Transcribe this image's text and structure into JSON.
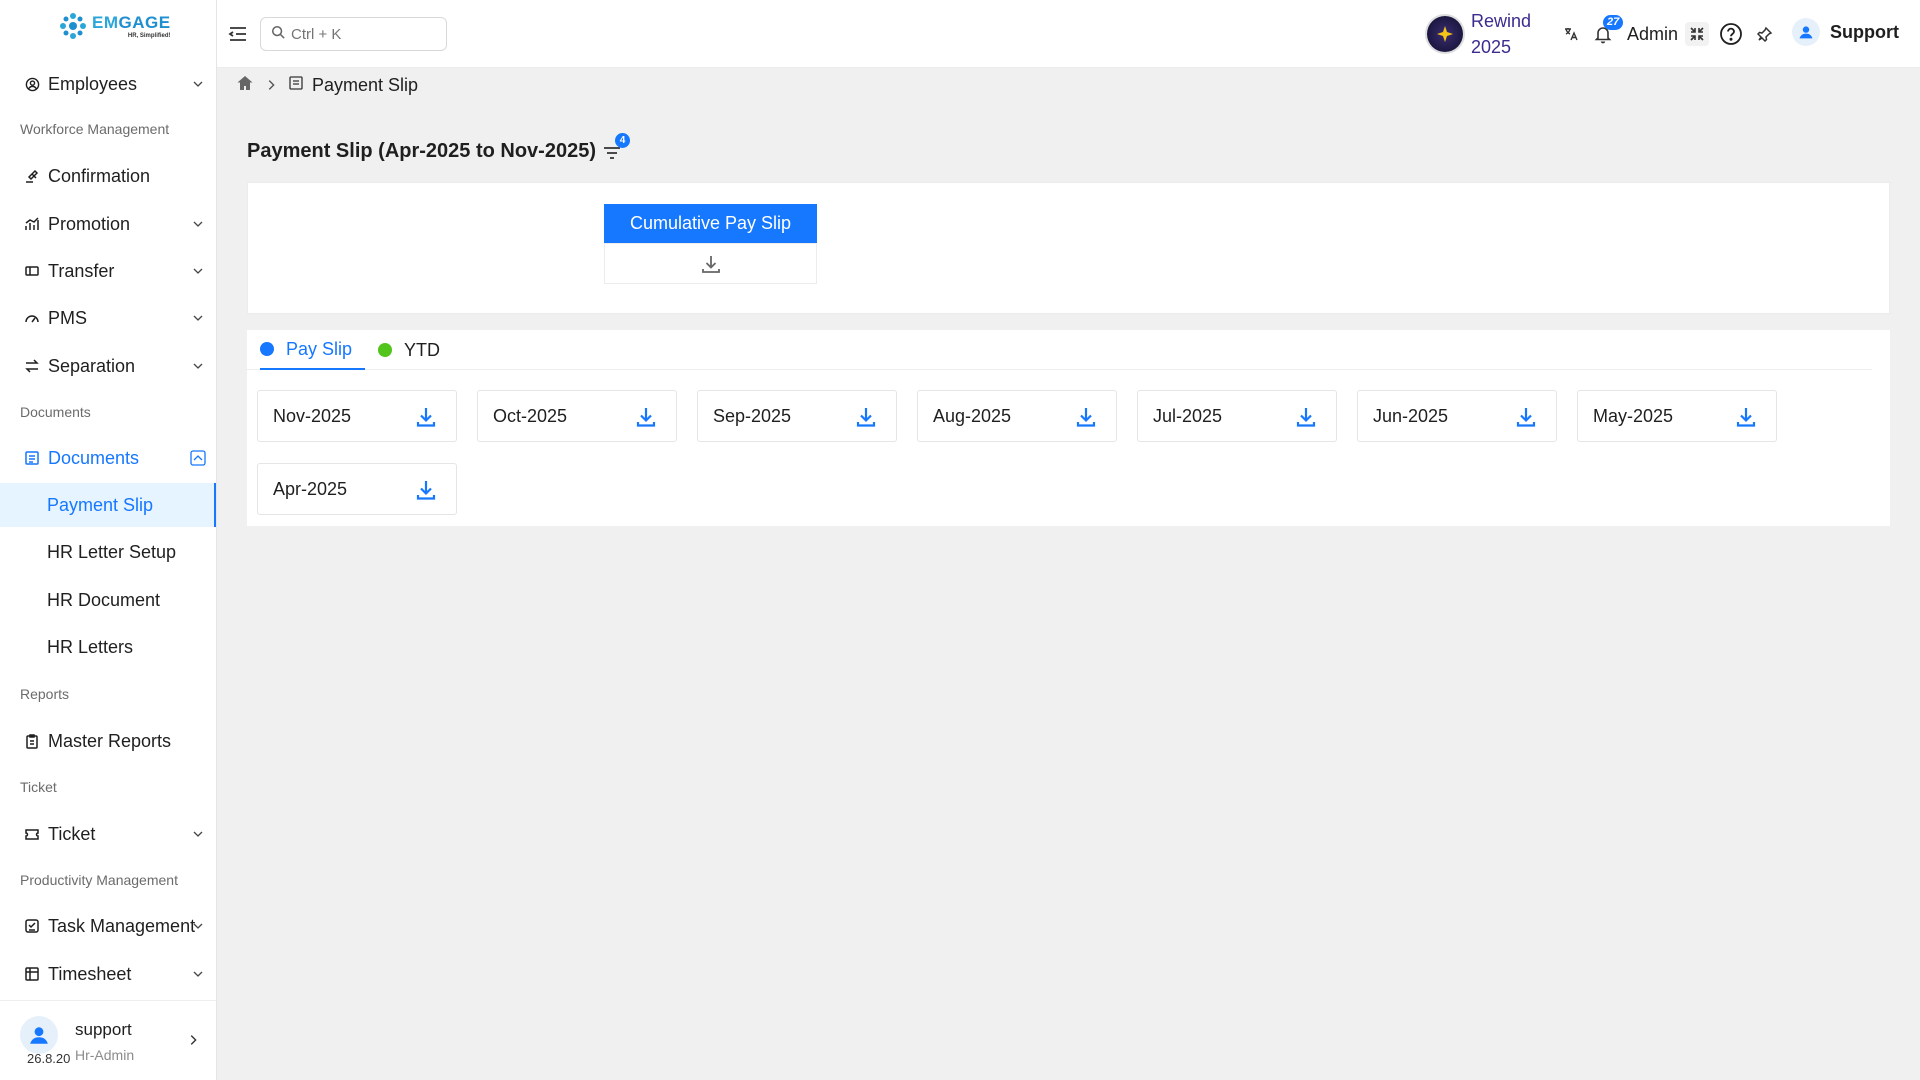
{
  "logo": {
    "word_em": "EM",
    "word_gage": "GAGE",
    "tagline": "HR, Simplified!"
  },
  "sidebar": {
    "items": [
      {
        "label": "Employees",
        "icon": "user-circle-icon"
      },
      {
        "label": "Confirmation",
        "icon": "gavel-icon"
      },
      {
        "label": "Promotion",
        "icon": "chart-icon"
      },
      {
        "label": "Transfer",
        "icon": "transfer-icon"
      },
      {
        "label": "PMS",
        "icon": "gauge-icon"
      },
      {
        "label": "Separation",
        "icon": "swap-icon"
      },
      {
        "label": "Documents",
        "icon": "document-icon"
      },
      {
        "label": "Payment Slip"
      },
      {
        "label": "HR Letter Setup"
      },
      {
        "label": "HR Document"
      },
      {
        "label": "HR Letters"
      },
      {
        "label": "Master Reports",
        "icon": "clipboard-icon"
      },
      {
        "label": "Ticket",
        "icon": "ticket-icon"
      },
      {
        "label": "Task Management",
        "icon": "task-icon"
      },
      {
        "label": "Timesheet",
        "icon": "table-icon"
      }
    ],
    "groups": {
      "workforce": "Workforce Management",
      "documents": "Documents",
      "reports": "Reports",
      "ticket": "Ticket",
      "productivity": "Productivity Management"
    },
    "user": {
      "name": "support",
      "role": "Hr-Admin",
      "version": "26.8.20"
    }
  },
  "header": {
    "search_placeholder": "Ctrl + K",
    "rewind_line1": "Rewind",
    "rewind_line2": "2025",
    "notif_count": "27",
    "role": "Admin",
    "user": "Support"
  },
  "breadcrumb": {
    "current": "Payment Slip"
  },
  "page": {
    "title": "Payment Slip (Apr-2025 to Nov-2025)",
    "filter_count": "4",
    "cumulative_label": "Cumulative Pay Slip"
  },
  "tabs": [
    {
      "label": "Pay Slip",
      "color": "#1677ff"
    },
    {
      "label": "YTD",
      "color": "#52c41a"
    }
  ],
  "slips": [
    "Nov-2025",
    "Oct-2025",
    "Sep-2025",
    "Aug-2025",
    "Jul-2025",
    "Jun-2025",
    "May-2025",
    "Apr-2025"
  ],
  "colors": {
    "accent": "#1677ff",
    "ytd": "#52c41a",
    "rewind": "#3b2c8f"
  }
}
